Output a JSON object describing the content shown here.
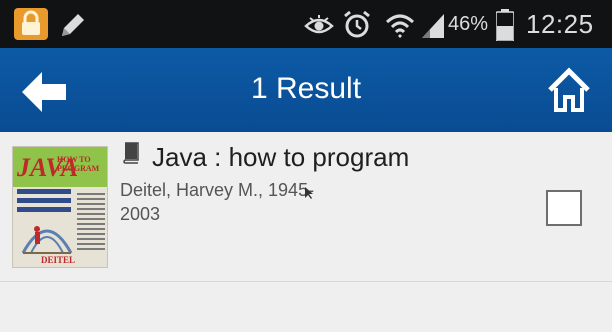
{
  "status_bar": {
    "battery_percent": "46%",
    "time": "12:25",
    "icons": [
      "lock-icon",
      "pencil-icon",
      "eye-icon",
      "alarm-icon",
      "wifi-icon",
      "signal-icon",
      "battery-icon"
    ]
  },
  "app_bar": {
    "title": "1 Result",
    "background_color": "#0b539d",
    "icons": [
      "back-arrow-icon",
      "home-icon"
    ]
  },
  "results": [
    {
      "title": "Java : how to program",
      "author": "Deitel, Harvey M., 1945-\n2003",
      "format_icon": "book-icon",
      "selected": false,
      "cover": {
        "brand": "JAVA",
        "subtitle": "HOW TO PROGRAM",
        "footer": "DEITEL"
      }
    }
  ]
}
